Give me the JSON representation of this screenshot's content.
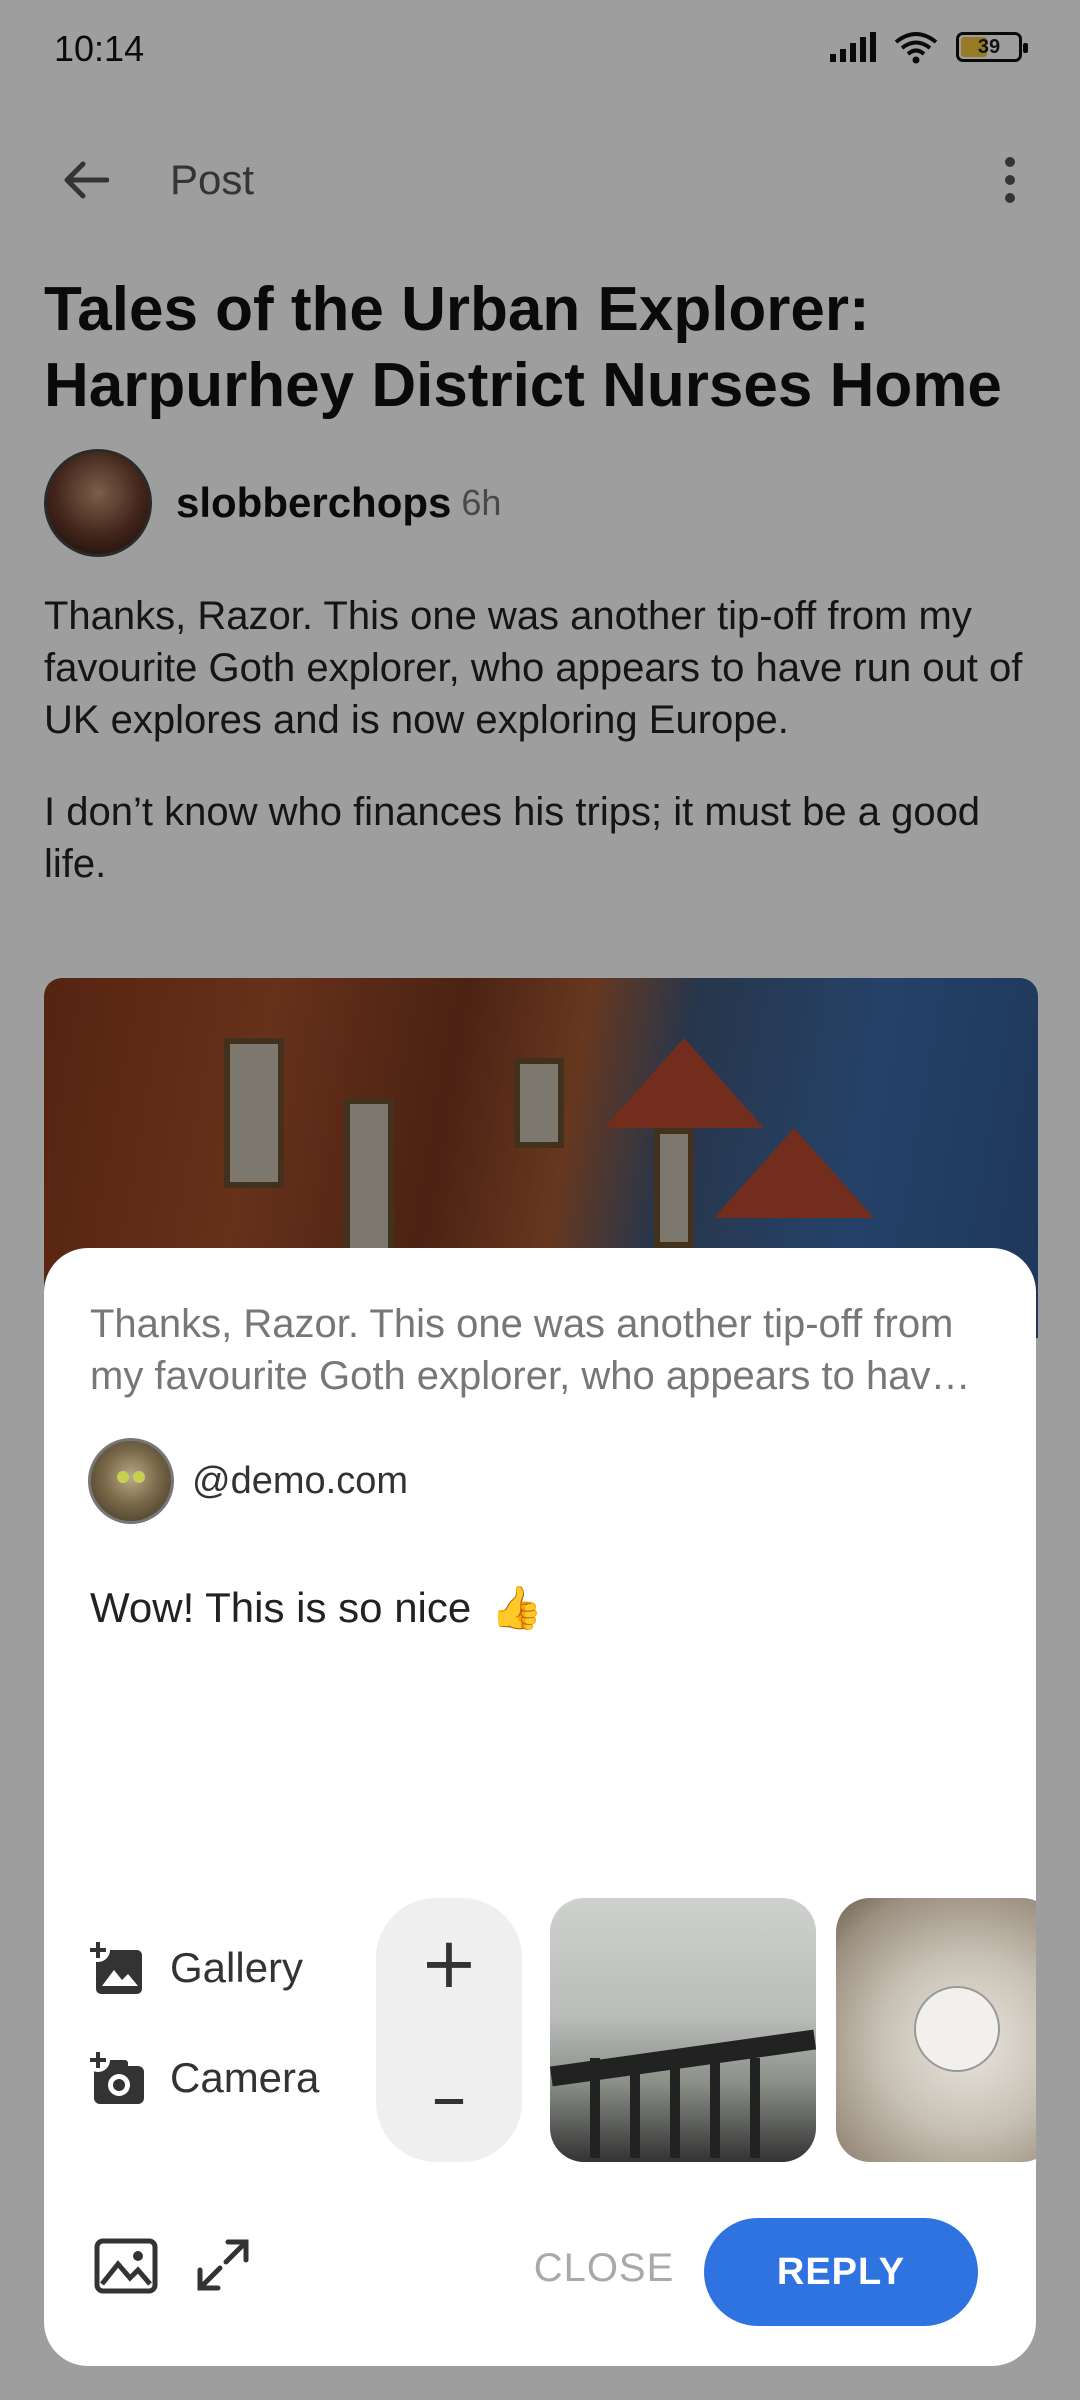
{
  "status_bar": {
    "time": "10:14",
    "battery": "39"
  },
  "app_bar": {
    "title": "Post"
  },
  "post": {
    "title": "Tales of the Urban Explorer: Harpurhey District Nurses Home",
    "author": "slobberchops",
    "age": "6h",
    "paragraphs": [
      "Thanks, Razor. This one was another tip-off from my favourite Goth explorer, who appears to have run out of UK explores and is now exploring Europe.",
      "I don’t know who finances his trips; it must be a good life."
    ]
  },
  "reply_sheet": {
    "quoted": "Thanks, Razor. This one was another tip-off from my favourite Goth explorer, who appears to have run out of UK explores and is now exploring Europe.",
    "account_handle": "@demo.com",
    "reply_text": "Wow! This is so nice",
    "reply_emoji": "👍",
    "attach_options": [
      {
        "label": "Gallery",
        "icon": "add-photo-icon"
      },
      {
        "label": "Camera",
        "icon": "add-camera-icon"
      }
    ],
    "stepper": {
      "plus": "+",
      "minus": "–"
    },
    "close_label": "CLOSE",
    "reply_label": "REPLY"
  },
  "colors": {
    "accent": "#2f73e0",
    "battery_fill": "#f3c53a",
    "scrim": "rgba(0,0,0,0.38)"
  }
}
